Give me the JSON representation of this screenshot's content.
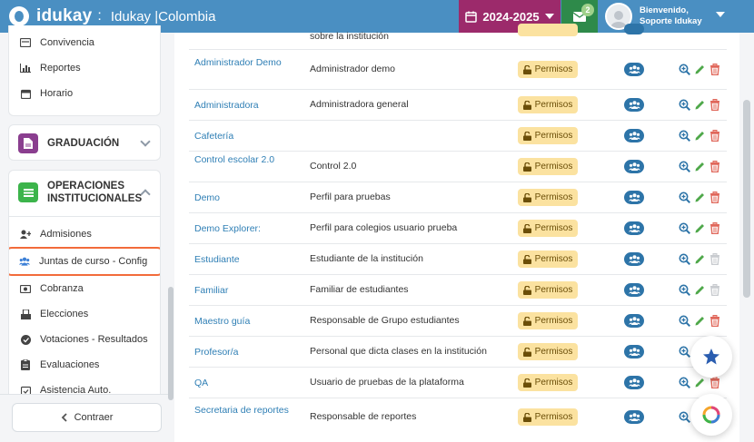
{
  "app": {
    "brand": "idukay",
    "brand_colon": ":",
    "school": "Idukay |Colombia",
    "year": "2024-2025",
    "mail_badge": "2",
    "welcome_line1": "Bienvenido,",
    "welcome_line2": "Soporte Idukay"
  },
  "sidebar": {
    "top_items": [
      {
        "label": "Convivencia",
        "icon": "card-icon"
      },
      {
        "label": "Reportes",
        "icon": "bar-chart-icon"
      },
      {
        "label": "Horario",
        "icon": "calendar-icon"
      }
    ],
    "graduacion": {
      "label": "GRADUACIÓN",
      "color": "#8a3e8f"
    },
    "operaciones": {
      "label_line1": "OPERACIONES",
      "label_line2": "INSTITUCIONALES",
      "color": "#3cb44b"
    },
    "op_items": [
      {
        "label": "Admisiones",
        "icon": "user-plus-icon"
      },
      {
        "label": "Juntas de curso - Config",
        "icon": "users-icon",
        "active": true
      },
      {
        "label": "Cobranza",
        "icon": "money-icon"
      },
      {
        "label": "Elecciones",
        "icon": "ballot-icon"
      },
      {
        "label": "Votaciones - Resultados",
        "icon": "check-circle-icon"
      },
      {
        "label": "Evaluaciones",
        "icon": "clipboard-icon"
      },
      {
        "label": "Asistencia Auto.",
        "icon": "calendar-check-icon"
      }
    ],
    "collapse_label": "Contraer"
  },
  "table": {
    "permissions_label": "Permisos",
    "partial_top_desc": "sobre la institución",
    "rows": [
      {
        "name": "Administrador Demo",
        "desc": "Administrador demo",
        "delete_enabled": true
      },
      {
        "name": "Administradora",
        "desc": "Administradora general",
        "delete_enabled": true
      },
      {
        "name": "Cafetería",
        "desc": "",
        "delete_enabled": true
      },
      {
        "name": "Control escolar 2.0",
        "desc": "Control 2.0",
        "delete_enabled": true
      },
      {
        "name": "Demo",
        "desc": "Perfil para pruebas",
        "delete_enabled": true
      },
      {
        "name": "Demo Explorer:",
        "desc": "Perfil para colegios usuario prueba",
        "delete_enabled": true
      },
      {
        "name": "Estudiante",
        "desc": "Estudiante de la institución",
        "delete_enabled": false
      },
      {
        "name": "Familiar",
        "desc": "Familiar de estudiantes",
        "delete_enabled": false
      },
      {
        "name": "Maestro guía",
        "desc": "Responsable de Grupo estudiantes",
        "delete_enabled": true
      },
      {
        "name": "Profesor/a",
        "desc": "Personal que dicta clases en la institución",
        "delete_enabled": true
      },
      {
        "name": "QA",
        "desc": "Usuario de pruebas de la plataforma",
        "delete_enabled": true
      },
      {
        "name": "Secretaria de reportes",
        "desc": "Responsable de reportes",
        "delete_enabled": true
      }
    ]
  },
  "colors": {
    "topbar": "#4a8fc2",
    "year": "#9c2a6b",
    "mail": "#2e8a4a",
    "link": "#2f7fb5",
    "permission": "#fbe2a0",
    "highlight": "#f26b3a"
  }
}
